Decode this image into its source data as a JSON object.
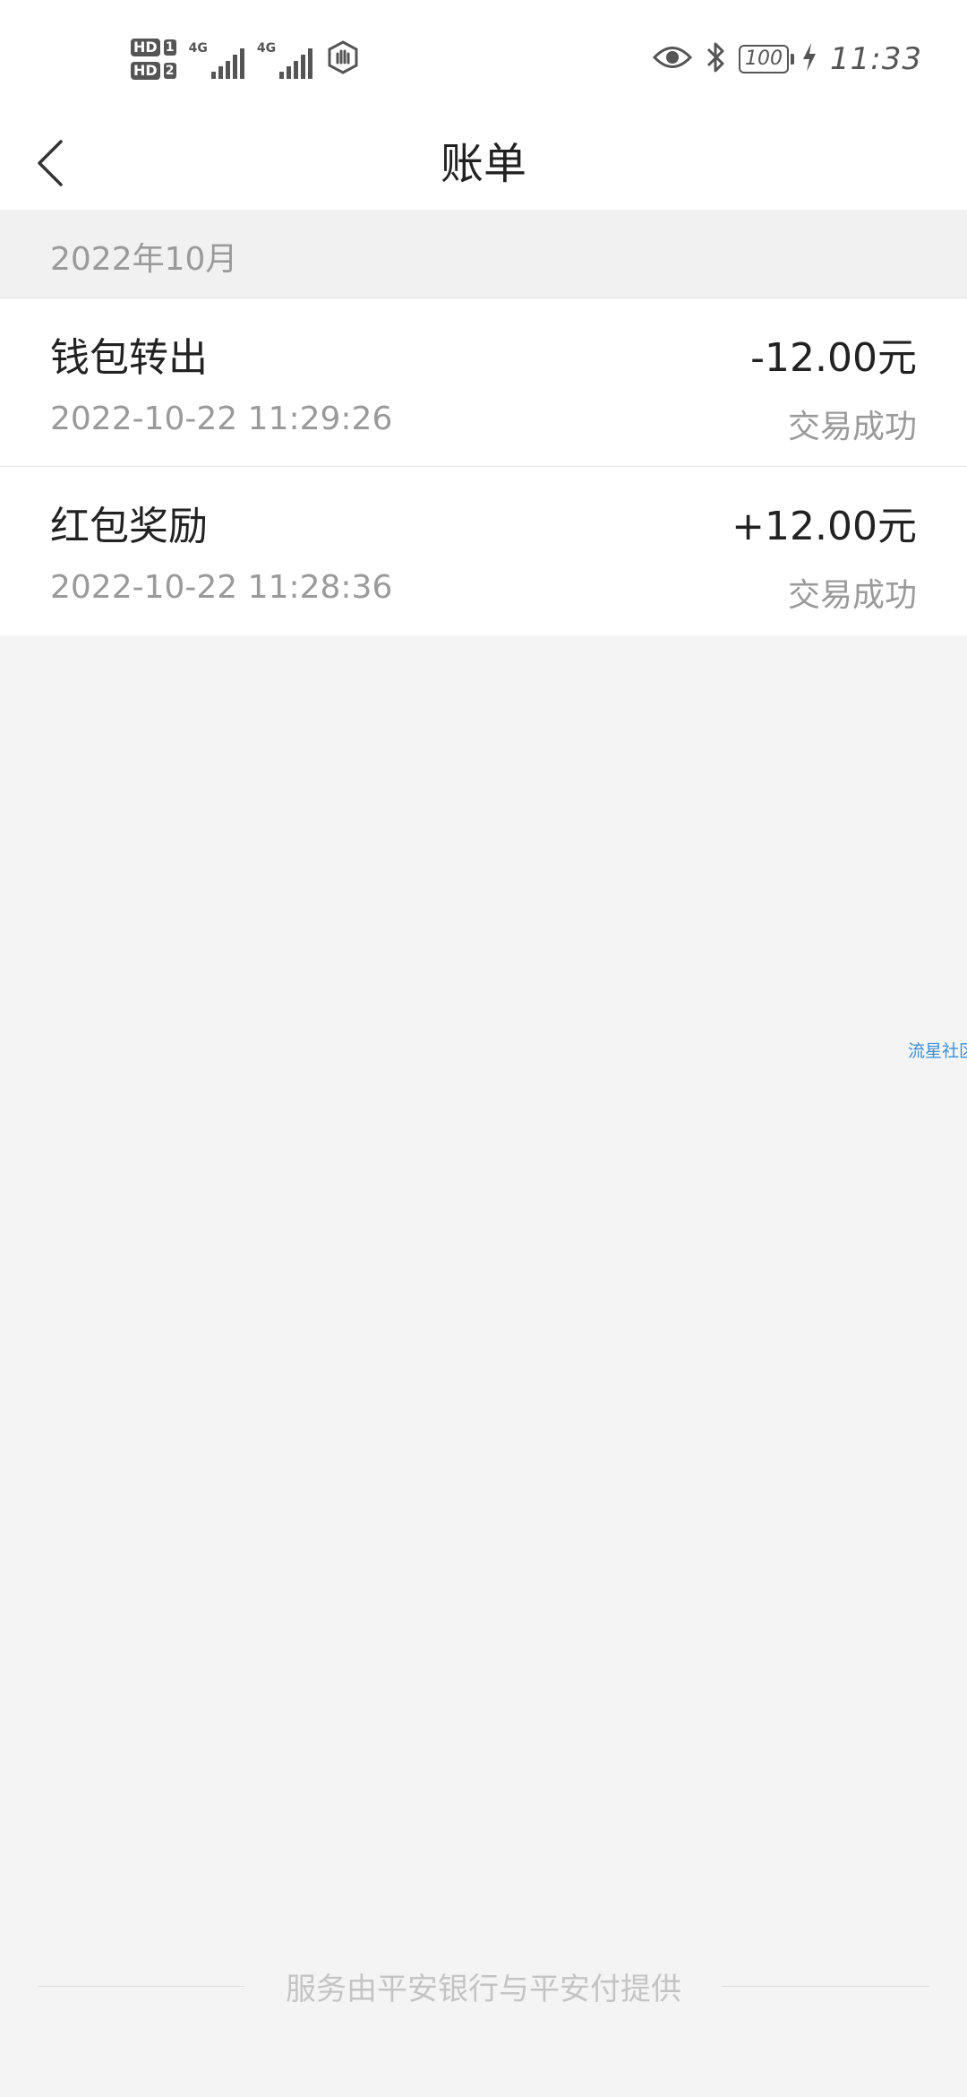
{
  "status_bar": {
    "hd1": "HD",
    "sim1": "1",
    "hd2": "HD",
    "sim2": "2",
    "net1": "4G",
    "net2": "4G",
    "battery": "100",
    "time": "11:33",
    "icons": [
      "signal-icon",
      "shield-hand-icon",
      "eye-icon",
      "bluetooth-icon",
      "battery-icon",
      "charging-bolt-icon"
    ]
  },
  "nav": {
    "title": "账单",
    "back_icon": "chevron-left-icon"
  },
  "month": "2022年10月",
  "transactions": [
    {
      "title": "钱包转出",
      "amount": "-12.00元",
      "time": "2022-10-22 11:29:26",
      "status": "交易成功"
    },
    {
      "title": "红包奖励",
      "amount": "+12.00元",
      "time": "2022-10-22 11:28:36",
      "status": "交易成功"
    }
  ],
  "watermark": "流星社区",
  "footer": "服务由平安银行与平安付提供"
}
